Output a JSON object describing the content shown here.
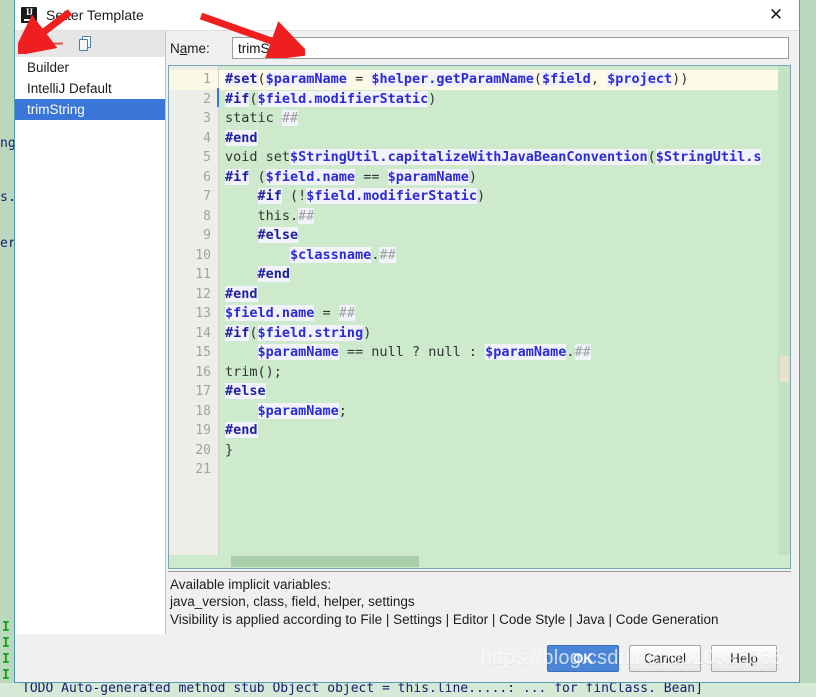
{
  "window": {
    "title": "Setter Template",
    "logo_icon": "intellij-idea-logo",
    "close_icon": "✕"
  },
  "list_panel": {
    "toolbar": {
      "add_icon": "+",
      "remove_icon": "−",
      "copy_icon": "copy-icon"
    },
    "items": [
      {
        "label": "Builder",
        "selected": false
      },
      {
        "label": "IntelliJ Default",
        "selected": false
      },
      {
        "label": "trimString",
        "selected": true
      }
    ]
  },
  "name_field": {
    "label_before": "N",
    "label_mnemonic": "a",
    "label_after": "me:",
    "value": "trimString",
    "placeholder": ""
  },
  "editor": {
    "current_line": 1,
    "line_numbers": [
      1,
      2,
      3,
      4,
      5,
      6,
      7,
      8,
      9,
      10,
      11,
      12,
      13,
      14,
      15,
      16,
      17,
      18,
      19,
      20,
      21
    ],
    "lines": [
      "#set($paramName = $helper.getParamName($field, $project))",
      "#if($field.modifierStatic)",
      "static ##",
      "#end",
      "void set$StringUtil.capitalizeWithJavaBeanConvention($StringUtil.s",
      "#if ($field.name == $paramName)",
      "    #if (!$field.modifierStatic)",
      "    this.##",
      "    #else",
      "        $classname.##",
      "    #end",
      "#end",
      "$field.name = ##",
      "#if($field.string)",
      "    $paramName == null ? null : $paramName.##",
      "trim();",
      "#else",
      "    $paramName;",
      "#end",
      "}",
      ""
    ]
  },
  "hints": {
    "line1": "Available implicit variables:",
    "line2": "java_version, class, field, helper, settings",
    "line3": "Visibility is applied according to File | Settings | Editor | Code Style | Java | Code Generation"
  },
  "buttons": {
    "ok": "OK",
    "cancel": "Cancel",
    "help": "Help"
  },
  "watermark": {
    "text": "https://blog.csdn.net/u010996565"
  },
  "background_ide": {
    "left_snippets": [
      "ng",
      "s.",
      "er"
    ],
    "green_markers": [
      "I",
      "I",
      "I",
      "I"
    ],
    "bottom_code": "TODO Auto-generated method stub Object object = this.line.....:       ...   for finClass. Bean]"
  },
  "colors": {
    "selection_blue": "#3a75d8",
    "editor_green": "#cdeacd",
    "current_line_cream": "#fdfbe8",
    "add_green": "#2fa02f",
    "remove_red": "#d9544d",
    "arrow_red": "#f01f1f",
    "primary_button": "#4a86d8",
    "keyword_navy": "#1f1f9e",
    "variable_blue": "#2b2bd8"
  }
}
